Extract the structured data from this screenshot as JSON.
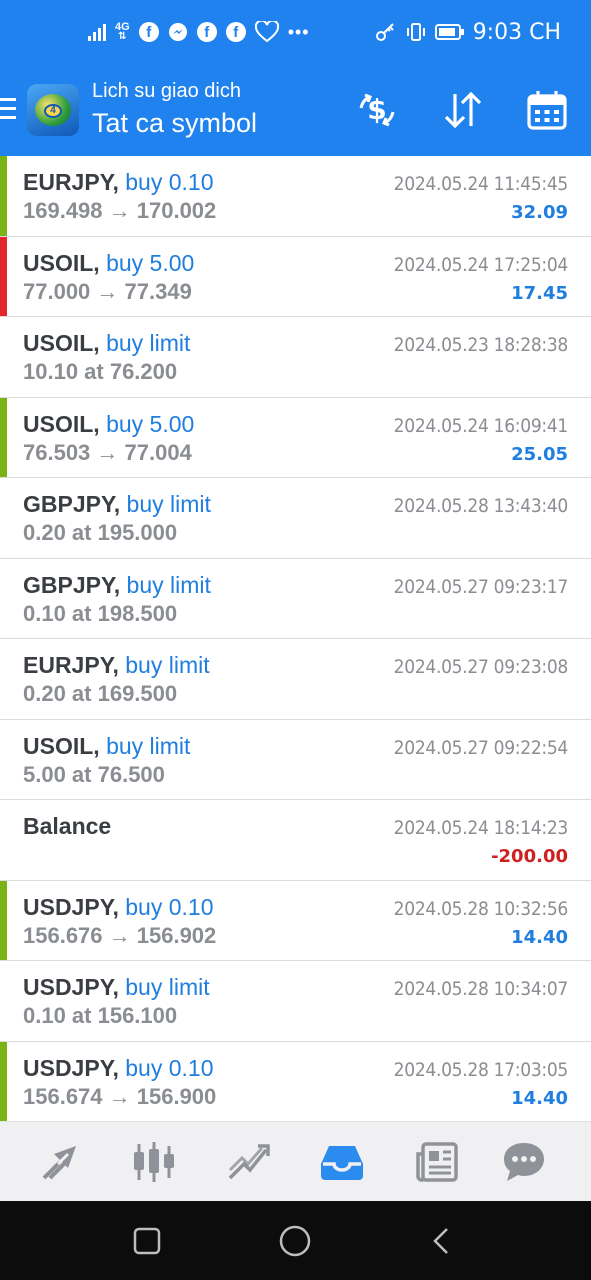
{
  "status_bar": {
    "network": "4G",
    "more": "•••",
    "time": "9:03 CH"
  },
  "header": {
    "subtitle": "Lich su giao dich",
    "title": "Tat ca symbol"
  },
  "colors": {
    "header_bg": "#2082ee",
    "action_blue": "#1f7ee0",
    "profit_positive": "#1f7ee0",
    "profit_negative": "#d01f1f",
    "bar_green": "#79b414",
    "bar_red": "#e3282d"
  },
  "history": [
    {
      "symbol": "EURJPY,",
      "action": "buy 0.10",
      "detail": "169.498 → 170.002",
      "time": "2024.05.24 11:45:45",
      "profit": "32.09",
      "bar": "green",
      "profit_sign": "pos"
    },
    {
      "symbol": "USOIL,",
      "action": "buy 5.00",
      "detail": "77.000 → 77.349",
      "time": "2024.05.24 17:25:04",
      "profit": "17.45",
      "bar": "red",
      "profit_sign": "pos"
    },
    {
      "symbol": "USOIL,",
      "action": "buy limit",
      "detail": "10.10 at 76.200",
      "time": "2024.05.23 18:28:38",
      "profit": "",
      "bar": "none",
      "profit_sign": "pos"
    },
    {
      "symbol": "USOIL,",
      "action": "buy 5.00",
      "detail": "76.503 → 77.004",
      "time": "2024.05.24 16:09:41",
      "profit": "25.05",
      "bar": "green",
      "profit_sign": "pos"
    },
    {
      "symbol": "GBPJPY,",
      "action": "buy limit",
      "detail": "0.20 at 195.000",
      "time": "2024.05.28 13:43:40",
      "profit": "",
      "bar": "none",
      "profit_sign": "pos"
    },
    {
      "symbol": "GBPJPY,",
      "action": "buy limit",
      "detail": "0.10 at 198.500",
      "time": "2024.05.27 09:23:17",
      "profit": "",
      "bar": "none",
      "profit_sign": "pos"
    },
    {
      "symbol": "EURJPY,",
      "action": "buy limit",
      "detail": "0.20 at 169.500",
      "time": "2024.05.27 09:23:08",
      "profit": "",
      "bar": "none",
      "profit_sign": "pos"
    },
    {
      "symbol": "USOIL,",
      "action": "buy limit",
      "detail": "5.00 at 76.500",
      "time": "2024.05.27 09:22:54",
      "profit": "",
      "bar": "none",
      "profit_sign": "pos"
    },
    {
      "symbol": "Balance",
      "action": "",
      "detail": "",
      "time": "2024.05.24 18:14:23",
      "profit": "-200.00",
      "bar": "none",
      "profit_sign": "neg"
    },
    {
      "symbol": "USDJPY,",
      "action": "buy 0.10",
      "detail": "156.676 → 156.902",
      "time": "2024.05.28 10:32:56",
      "profit": "14.40",
      "bar": "green",
      "profit_sign": "pos"
    },
    {
      "symbol": "USDJPY,",
      "action": "buy limit",
      "detail": "0.10 at 156.100",
      "time": "2024.05.28 10:34:07",
      "profit": "",
      "bar": "none",
      "profit_sign": "pos"
    },
    {
      "symbol": "USDJPY,",
      "action": "buy 0.10",
      "detail": "156.674 → 156.900",
      "time": "2024.05.28 17:03:05",
      "profit": "14.40",
      "bar": "green",
      "profit_sign": "pos"
    }
  ],
  "tabs": [
    {
      "icon": "quotes-arrows-icon",
      "active": false
    },
    {
      "icon": "candlestick-chart-icon",
      "active": false
    },
    {
      "icon": "trade-trend-icon",
      "active": false
    },
    {
      "icon": "history-inbox-icon",
      "active": true
    },
    {
      "icon": "news-icon",
      "active": false
    },
    {
      "icon": "chat-icon",
      "active": false
    }
  ]
}
